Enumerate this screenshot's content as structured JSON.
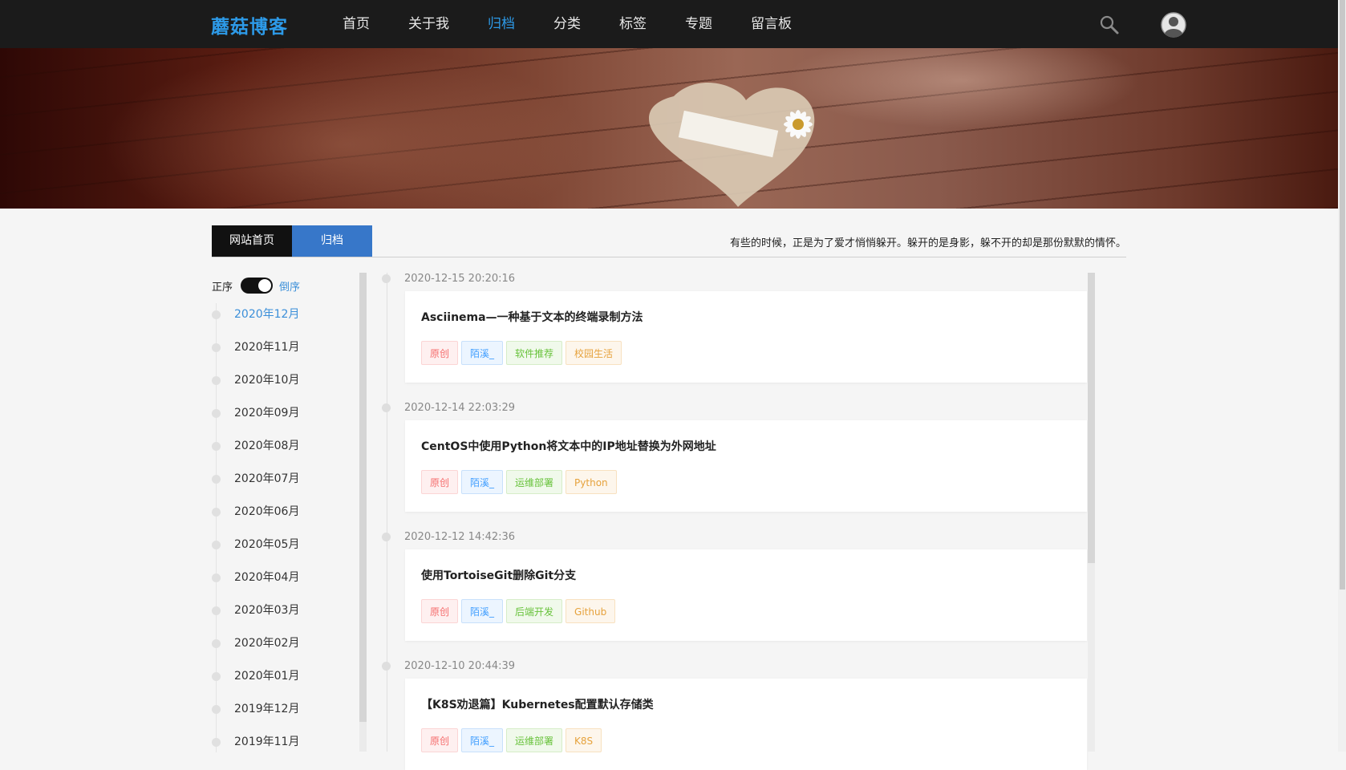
{
  "header": {
    "logo": "蘑菇博客",
    "nav": [
      {
        "label": "首页",
        "active": false
      },
      {
        "label": "关于我",
        "active": false
      },
      {
        "label": "归档",
        "active": true
      },
      {
        "label": "分类",
        "active": false
      },
      {
        "label": "标签",
        "active": false
      },
      {
        "label": "专题",
        "active": false
      },
      {
        "label": "留言板",
        "active": false
      }
    ],
    "search_icon": "search-icon",
    "avatar_icon": "user-avatar-icon"
  },
  "tabs": {
    "home": "网站首页",
    "archive": "归档"
  },
  "motto": "有些的时候，正是为了爱才悄悄躲开。躲开的是身影，躲不开的却是那份默默的情怀。",
  "sort": {
    "asc": "正序",
    "desc": "倒序",
    "toggle_on": true
  },
  "months": [
    "2020年12月",
    "2020年11月",
    "2020年10月",
    "2020年09月",
    "2020年08月",
    "2020年07月",
    "2020年06月",
    "2020年05月",
    "2020年04月",
    "2020年03月",
    "2020年02月",
    "2020年01月",
    "2019年12月",
    "2019年11月"
  ],
  "active_month": 0,
  "entries": [
    {
      "date": "2020-12-15 20:20:16",
      "title": "Asciinema—一种基于文本的终端录制方法",
      "tags": [
        {
          "label": "原创",
          "color": "red"
        },
        {
          "label": "陌溪_",
          "color": "blue"
        },
        {
          "label": "软件推荐",
          "color": "green"
        },
        {
          "label": "校园生活",
          "color": "orange"
        }
      ]
    },
    {
      "date": "2020-12-14 22:03:29",
      "title": "CentOS中使用Python将文本中的IP地址替换为外网地址",
      "tags": [
        {
          "label": "原创",
          "color": "red"
        },
        {
          "label": "陌溪_",
          "color": "blue"
        },
        {
          "label": "运维部署",
          "color": "green"
        },
        {
          "label": "Python",
          "color": "orange"
        }
      ]
    },
    {
      "date": "2020-12-12 14:42:36",
      "title": "使用TortoiseGit删除Git分支",
      "tags": [
        {
          "label": "原创",
          "color": "red"
        },
        {
          "label": "陌溪_",
          "color": "blue"
        },
        {
          "label": "后端开发",
          "color": "green"
        },
        {
          "label": "Github",
          "color": "orange"
        }
      ]
    },
    {
      "date": "2020-12-10 20:44:39",
      "title": "【K8S劝退篇】Kubernetes配置默认存储类",
      "tags": [
        {
          "label": "原创",
          "color": "red"
        },
        {
          "label": "陌溪_",
          "color": "blue"
        },
        {
          "label": "运维部署",
          "color": "green"
        },
        {
          "label": "K8S",
          "color": "orange"
        }
      ]
    }
  ]
}
